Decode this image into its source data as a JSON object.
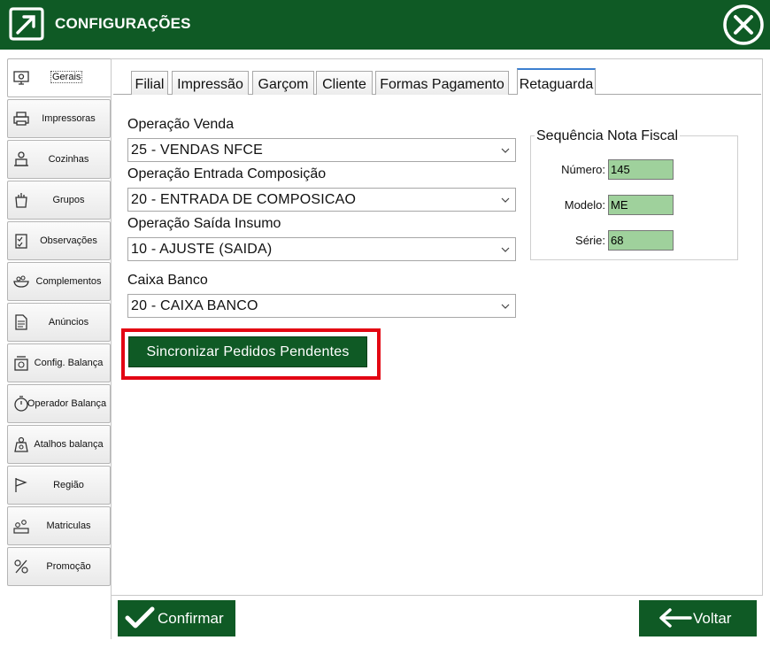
{
  "header": {
    "title": "CONFIGURAÇÕES",
    "colors": {
      "brand": "#0f5a25",
      "highlight": "#e30613",
      "input_bg": "#9fd19c",
      "tab_accent": "#3c7fd0"
    }
  },
  "sidebar": {
    "items": [
      {
        "label": "Gerais",
        "icon": "monitor-gear-icon",
        "active": true
      },
      {
        "label": "Impressoras",
        "icon": "printer-icon"
      },
      {
        "label": "Cozinhas",
        "icon": "chef-icon"
      },
      {
        "label": "Grupos",
        "icon": "grocery-bag-icon"
      },
      {
        "label": "Observações",
        "icon": "checklist-icon"
      },
      {
        "label": "Complementos",
        "icon": "bowl-icon"
      },
      {
        "label": "Anúncios",
        "icon": "document-icon"
      },
      {
        "label": "Config. Balança",
        "icon": "scale-icon"
      },
      {
        "label": "Operador  Balança",
        "icon": "stopwatch-icon"
      },
      {
        "label": "Atalhos balança",
        "icon": "scale-shortcut-icon"
      },
      {
        "label": "Região",
        "icon": "flag-icon"
      },
      {
        "label": "Matriculas",
        "icon": "people-icon"
      },
      {
        "label": "Promoção",
        "icon": "promotion-icon"
      }
    ]
  },
  "tabs": [
    {
      "label": "Filial"
    },
    {
      "label": "Impressão"
    },
    {
      "label": "Garçom"
    },
    {
      "label": "Cliente"
    },
    {
      "label": "Formas Pagamento"
    },
    {
      "label": "Retaguarda",
      "active": true
    }
  ],
  "form": {
    "operacao_venda": {
      "label": "Operação Venda",
      "value": "25 - VENDAS NFCE"
    },
    "operacao_entrada": {
      "label": "Operação Entrada Composição",
      "value": "20 - ENTRADA DE COMPOSICAO"
    },
    "operacao_saida": {
      "label": "Operação Saída Insumo",
      "value": "10 - AJUSTE (SAIDA)"
    },
    "caixa_banco": {
      "label": "Caixa Banco",
      "value": "20 - CAIXA BANCO"
    },
    "sync_button": "Sincronizar Pedidos Pendentes"
  },
  "sequencia": {
    "title": "Sequência Nota Fiscal",
    "numero": {
      "label": "Número:",
      "value": "145"
    },
    "modelo": {
      "label": "Modelo:",
      "value": "ME"
    },
    "serie": {
      "label": "Série:",
      "value": "68"
    }
  },
  "footer": {
    "confirm": "Confirmar",
    "back": "Voltar"
  }
}
